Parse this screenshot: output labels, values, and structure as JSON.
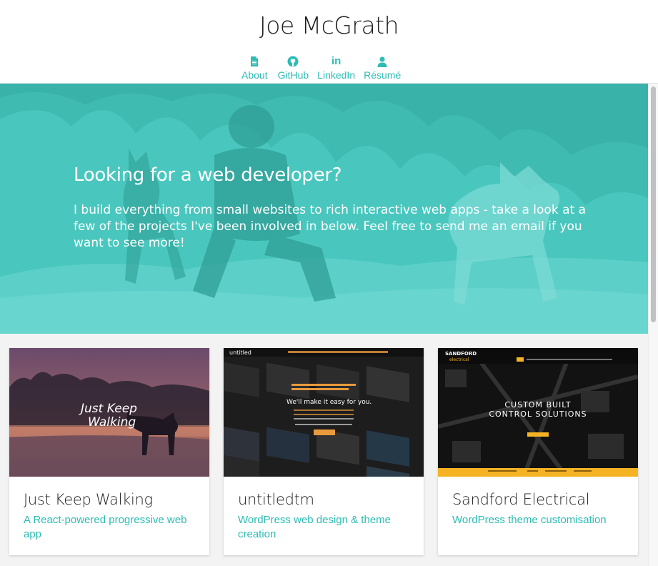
{
  "header": {
    "title": "Joe McGrath",
    "nav": [
      {
        "label": "About",
        "icon": "document-icon"
      },
      {
        "label": "GitHub",
        "icon": "github-icon"
      },
      {
        "label": "LinkedIn",
        "icon": "linkedin-icon"
      },
      {
        "label": "Résumé",
        "icon": "user-icon"
      }
    ],
    "linkedin_glyph": "in"
  },
  "hero": {
    "title": "Looking for a web developer?",
    "text": "I build everything from small websites to rich interactive web apps - take a look at a few of the projects I've been involved in below. Feel free to send me an email if you want to see more!"
  },
  "projects": [
    {
      "title": "Just Keep Walking",
      "description": "A React-powered progressive web app",
      "thumb_text_line1": "Just Keep",
      "thumb_text_line2": "Walking"
    },
    {
      "title": "untitledtm",
      "description": "WordPress web design & theme creation",
      "thumb_brand": "untitled",
      "thumb_headline": "We'll make it easy for you."
    },
    {
      "title": "Sandford Electrical",
      "description": "WordPress theme customisation",
      "thumb_brand": "SANDFORD",
      "thumb_brand_sub": "electrical",
      "thumb_headline_line1": "CUSTOM BUILT",
      "thumb_headline_line2": "CONTROL SOLUTIONS"
    }
  ],
  "colors": {
    "accent": "#2ebcb4",
    "hero_overlay": "#45c5bc",
    "sandford_yellow": "#f5b324"
  }
}
